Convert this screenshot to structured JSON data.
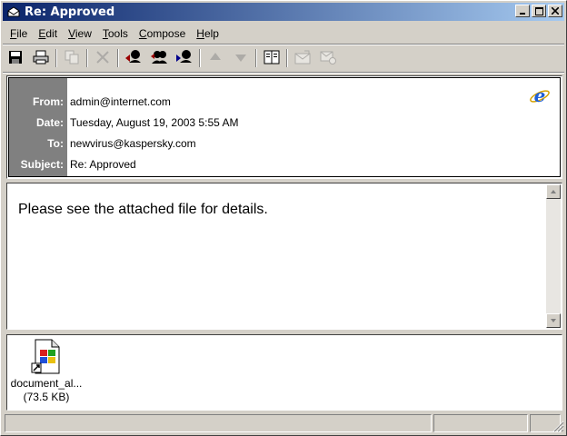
{
  "window": {
    "title": "Re: Approved"
  },
  "menu": [
    {
      "label": "File",
      "accel": "F",
      "rest": "ile"
    },
    {
      "label": "Edit",
      "accel": "E",
      "rest": "dit"
    },
    {
      "label": "View",
      "accel": "V",
      "rest": "iew"
    },
    {
      "label": "Tools",
      "accel": "T",
      "rest": "ools"
    },
    {
      "label": "Compose",
      "accel": "C",
      "rest": "ompose"
    },
    {
      "label": "Help",
      "accel": "H",
      "rest": "elp"
    }
  ],
  "toolbar": {
    "icons": [
      "save-icon",
      "print-icon",
      "copy-icon",
      "delete-icon",
      "reply-icon",
      "reply-all-icon",
      "forward-icon",
      "previous-icon",
      "next-icon",
      "address-book-icon",
      "send-receive-icon",
      "mail-icon"
    ]
  },
  "header": {
    "labels": {
      "from": "From:",
      "date": "Date:",
      "to": "To:",
      "subject": "Subject:"
    },
    "from": "admin@internet.com",
    "date": "Tuesday, August 19, 2003 5:55 AM",
    "to": "newvirus@kaspersky.com",
    "subject": "Re: Approved"
  },
  "body": {
    "text": "Please see the attached file for details."
  },
  "attachment": {
    "name": "document_al...",
    "size": "(73.5 KB)"
  },
  "colors": {
    "titlebar_start": "#0a246a",
    "titlebar_end": "#a6caf0",
    "label_bg": "#808080",
    "chrome": "#d4d0c8"
  }
}
